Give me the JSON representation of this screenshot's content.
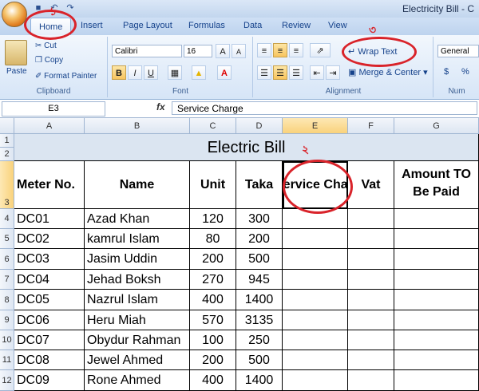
{
  "window": {
    "title": "Electricity Bill - C"
  },
  "ribbon_tabs": [
    "Home",
    "Insert",
    "Page Layout",
    "Formulas",
    "Data",
    "Review",
    "View"
  ],
  "clipboard": {
    "paste": "Paste",
    "cut": "Cut",
    "copy": "Copy",
    "format_painter": "Format Painter",
    "label": "Clipboard"
  },
  "font": {
    "name": "Calibri",
    "size": "16",
    "bold": "B",
    "italic": "I",
    "underline": "U",
    "label": "Font"
  },
  "alignment": {
    "wrap_text": "Wrap Text",
    "merge_center": "Merge & Center",
    "label": "Alignment"
  },
  "number": {
    "format": "General",
    "currency": "$",
    "percent": "%",
    "label": "Num"
  },
  "formula_bar": {
    "name_box": "E3",
    "fx": "fx",
    "content": "Service Charge"
  },
  "columns": [
    "A",
    "B",
    "C",
    "D",
    "E",
    "F",
    "G"
  ],
  "row_numbers": [
    "1",
    "2",
    "3",
    "4",
    "5",
    "6",
    "7",
    "8",
    "9",
    "10",
    "11",
    "12"
  ],
  "sheet": {
    "title": "Electric Bill",
    "headers": [
      "Meter No.",
      "Name",
      "Unit",
      "Taka",
      "Service Charge",
      "Vat",
      "Amount TO Be Paid"
    ],
    "rows": [
      [
        "DC01",
        "Azad Khan",
        "120",
        "300"
      ],
      [
        "DC02",
        "kamrul Islam",
        "80",
        "200"
      ],
      [
        "DC03",
        "Jasim Uddin",
        "200",
        "500"
      ],
      [
        "DC04",
        "Jehad Boksh",
        "270",
        "945"
      ],
      [
        "DC05",
        "Nazrul Islam",
        "400",
        "1400"
      ],
      [
        "DC06",
        "Heru Miah",
        "570",
        "3135"
      ],
      [
        "DC07",
        "Obydur Rahman",
        "100",
        "250"
      ],
      [
        "DC08",
        "Jewel Ahmed",
        "200",
        "500"
      ],
      [
        "DC09",
        "Rone Ahmed",
        "400",
        "1400"
      ]
    ]
  },
  "annotations": {
    "mark1": "১",
    "mark2": "২",
    "mark3": "৩",
    "color": "#d9232a"
  }
}
